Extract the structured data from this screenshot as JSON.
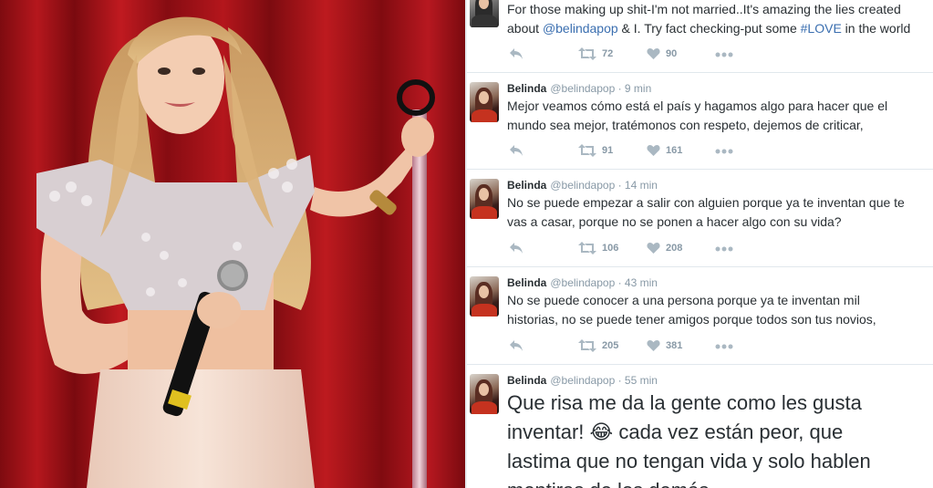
{
  "tweets": [
    {
      "name": "",
      "handle": "",
      "time": "",
      "line1_a": "For those making up shit-I'm not married..It's amazing the lies created",
      "line2_a": "about ",
      "line2_mention": "@belindapop",
      "line2_b": " & I. Try fact checking-put some ",
      "line2_hashtag": "#LOVE",
      "line2_c": " in the world",
      "retweets": "72",
      "likes": "90"
    },
    {
      "name": "Belinda",
      "handle": "@belindapop",
      "time": "· 9 min",
      "line1": "Mejor veamos cómo está el país y hagamos algo para hacer que el",
      "line2": "mundo sea mejor, tratémonos con respeto, dejemos de criticar,",
      "retweets": "91",
      "likes": "161"
    },
    {
      "name": "Belinda",
      "handle": "@belindapop",
      "time": "· 14 min",
      "line1": "No se puede empezar a salir con alguien porque ya te inventan que te",
      "line2": "vas a casar, porque no se ponen a hacer algo con su vida?",
      "retweets": "106",
      "likes": "208"
    },
    {
      "name": "Belinda",
      "handle": "@belindapop",
      "time": "· 43 min",
      "line1": "No se puede conocer a una persona porque ya te inventan mil",
      "line2": "historias, no se puede tener amigos porque todos son tus novios,",
      "retweets": "205",
      "likes": "381"
    },
    {
      "name": "Belinda",
      "handle": "@belindapop",
      "time": "· 55 min",
      "line1": "Que risa me da la gente como les gusta",
      "line2_a": "inventar! ",
      "emoji": "😂",
      "line2_b": " cada vez están peor, que",
      "line3": "lastima que no tengan vida y solo hablen",
      "line4": "mentiras de los demás"
    }
  ],
  "colors": {
    "curtain": "#9a0f14",
    "link": "#3b6fb0",
    "text": "#292f33",
    "muted": "#8899a6"
  },
  "icons": [
    "reply-icon",
    "retweet-icon",
    "heart-icon",
    "more-icon"
  ]
}
